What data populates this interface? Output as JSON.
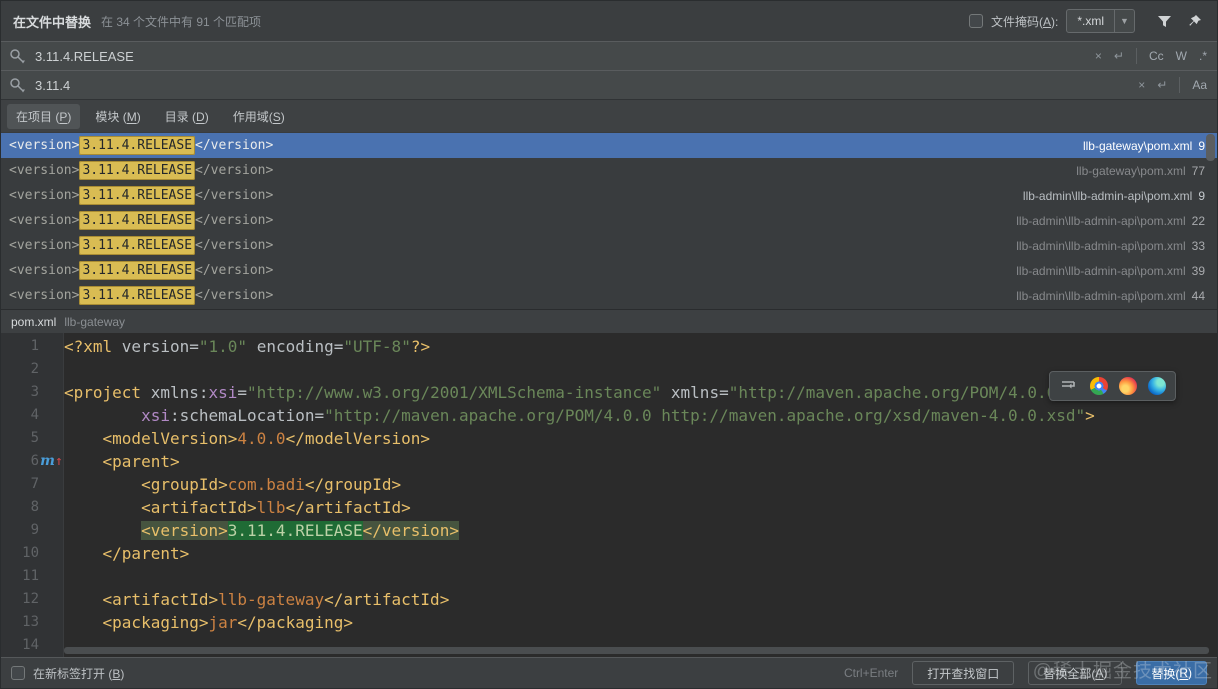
{
  "colors": {
    "selection_blue": "#4A72B0",
    "match_yellow": "#D9BC53",
    "editor_match_green": "#1F6B35",
    "primary_button_blue": "#3A6DA6"
  },
  "titlebar": {
    "title": "在文件中替换",
    "summary": "在 34 个文件中有 91 个匹配项",
    "file_mask": {
      "pre": "文件掩码(",
      "key": "A",
      "post": "):"
    },
    "file_mask_value": "*.xml"
  },
  "search": {
    "value": "3.11.4.RELEASE",
    "clear": "×",
    "newline": "↵",
    "match_case": "Cc",
    "words": "W",
    "regex": ".*"
  },
  "replace": {
    "value": "3.11.4",
    "clear": "×",
    "newline": "↵",
    "preserve_case": "Aa"
  },
  "scope_tabs": [
    {
      "pre": "在项目 (",
      "key": "P",
      "post": ")",
      "active": true
    },
    {
      "pre": "模块 (",
      "key": "M",
      "post": ")"
    },
    {
      "pre": "目录 (",
      "key": "D",
      "post": ")"
    },
    {
      "pre": "作用域(",
      "key": "S",
      "post": ")"
    }
  ],
  "results": {
    "snippet": {
      "before": "<version>",
      "match": "3.11.4.RELEASE",
      "after": "</version>"
    },
    "rows": [
      {
        "path": "llb-gateway\\pom.xml",
        "line": "9",
        "selected": true
      },
      {
        "path": "llb-gateway\\pom.xml",
        "line": "77"
      },
      {
        "path": "llb-admin\\llb-admin-api\\pom.xml",
        "line": "9",
        "bright": true
      },
      {
        "path": "llb-admin\\llb-admin-api\\pom.xml",
        "line": "22"
      },
      {
        "path": "llb-admin\\llb-admin-api\\pom.xml",
        "line": "33"
      },
      {
        "path": "llb-admin\\llb-admin-api\\pom.xml",
        "line": "39"
      },
      {
        "path": "llb-admin\\llb-admin-api\\pom.xml",
        "line": "44"
      }
    ]
  },
  "preview": {
    "file_name": "pom.xml",
    "module": "llb-gateway",
    "code_lines": [
      {
        "num": "1",
        "tokens": [
          [
            "<?xml ",
            "tag"
          ],
          [
            "version",
            "attr"
          ],
          [
            "=",
            "attr"
          ],
          [
            "\"1.0\"",
            "str"
          ],
          [
            " ",
            ""
          ],
          [
            "encoding",
            "attr"
          ],
          [
            "=",
            "attr"
          ],
          [
            "\"UTF-8\"",
            "str"
          ],
          [
            "?>",
            "tag"
          ]
        ]
      },
      {
        "num": "2",
        "tokens": []
      },
      {
        "num": "3",
        "tokens": [
          [
            "<project ",
            "tag"
          ],
          [
            "xmlns:",
            "attr"
          ],
          [
            "xsi",
            "ns"
          ],
          [
            "=",
            "attr"
          ],
          [
            "\"http://www.w3.org/2001/XMLSchema-instance\"",
            "str"
          ],
          [
            " ",
            ""
          ],
          [
            "xmlns",
            "attr"
          ],
          [
            "=",
            "attr"
          ],
          [
            "\"http://maven.apache.org/POM/4.0.0\"",
            "str"
          ]
        ]
      },
      {
        "num": "4",
        "tokens": [
          [
            "        ",
            ""
          ],
          [
            "xsi",
            "ns"
          ],
          [
            ":schemaLocation",
            "attr"
          ],
          [
            "=",
            "attr"
          ],
          [
            "\"http://maven.apache.org/POM/4.0.0 http://maven.apache.org/xsd/maven-4.0.0.xsd\"",
            "str"
          ],
          [
            ">",
            "tag"
          ]
        ]
      },
      {
        "num": "5",
        "tokens": [
          [
            "    ",
            ""
          ],
          [
            "<modelVersion>",
            "tag"
          ],
          [
            "4.0.0",
            "txt"
          ],
          [
            "</modelVersion>",
            "tag"
          ]
        ]
      },
      {
        "num": "6",
        "gutter": "maven-parent-icon",
        "tokens": [
          [
            "    ",
            ""
          ],
          [
            "<parent>",
            "tag"
          ]
        ]
      },
      {
        "num": "7",
        "tokens": [
          [
            "        ",
            ""
          ],
          [
            "<groupId>",
            "tag"
          ],
          [
            "com.badi",
            "txt"
          ],
          [
            "</groupId>",
            "tag"
          ]
        ]
      },
      {
        "num": "8",
        "tokens": [
          [
            "        ",
            ""
          ],
          [
            "<artifactId>",
            "tag"
          ],
          [
            "llb",
            "txt"
          ],
          [
            "</artifactId>",
            "tag"
          ]
        ]
      },
      {
        "num": "9",
        "tokens": [
          [
            "        ",
            ""
          ],
          [
            "<version>",
            "taghl"
          ],
          [
            "3.11.4.RELEASE",
            "match"
          ],
          [
            "</version>",
            "taghl"
          ]
        ]
      },
      {
        "num": "10",
        "tokens": [
          [
            "    ",
            ""
          ],
          [
            "</parent>",
            "tag"
          ]
        ]
      },
      {
        "num": "11",
        "tokens": []
      },
      {
        "num": "12",
        "tokens": [
          [
            "    ",
            ""
          ],
          [
            "<artifactId>",
            "tag"
          ],
          [
            "llb-gateway",
            "txt"
          ],
          [
            "</artifactId>",
            "tag"
          ]
        ]
      },
      {
        "num": "13",
        "tokens": [
          [
            "    ",
            ""
          ],
          [
            "<packaging>",
            "tag"
          ],
          [
            "jar",
            "txt"
          ],
          [
            "</packaging>",
            "tag"
          ]
        ]
      },
      {
        "num": "14",
        "tokens": []
      }
    ]
  },
  "browser_toolbar": {
    "icons": [
      "wrap-icon",
      "chrome-icon",
      "firefox-icon",
      "edge-icon"
    ]
  },
  "footer": {
    "open_in_new_tab": {
      "pre": "在新标签打开 (",
      "key": "B",
      "post": ")"
    },
    "shortcut_hint": "Ctrl+Enter",
    "open_find_window": "打开查找窗口",
    "replace_all": {
      "pre": "替换全部(",
      "key": "A",
      "post": ")"
    },
    "replace": {
      "pre": "替换(",
      "key": "R",
      "post": ")"
    }
  },
  "watermark": "@稀土掘金技术社区"
}
